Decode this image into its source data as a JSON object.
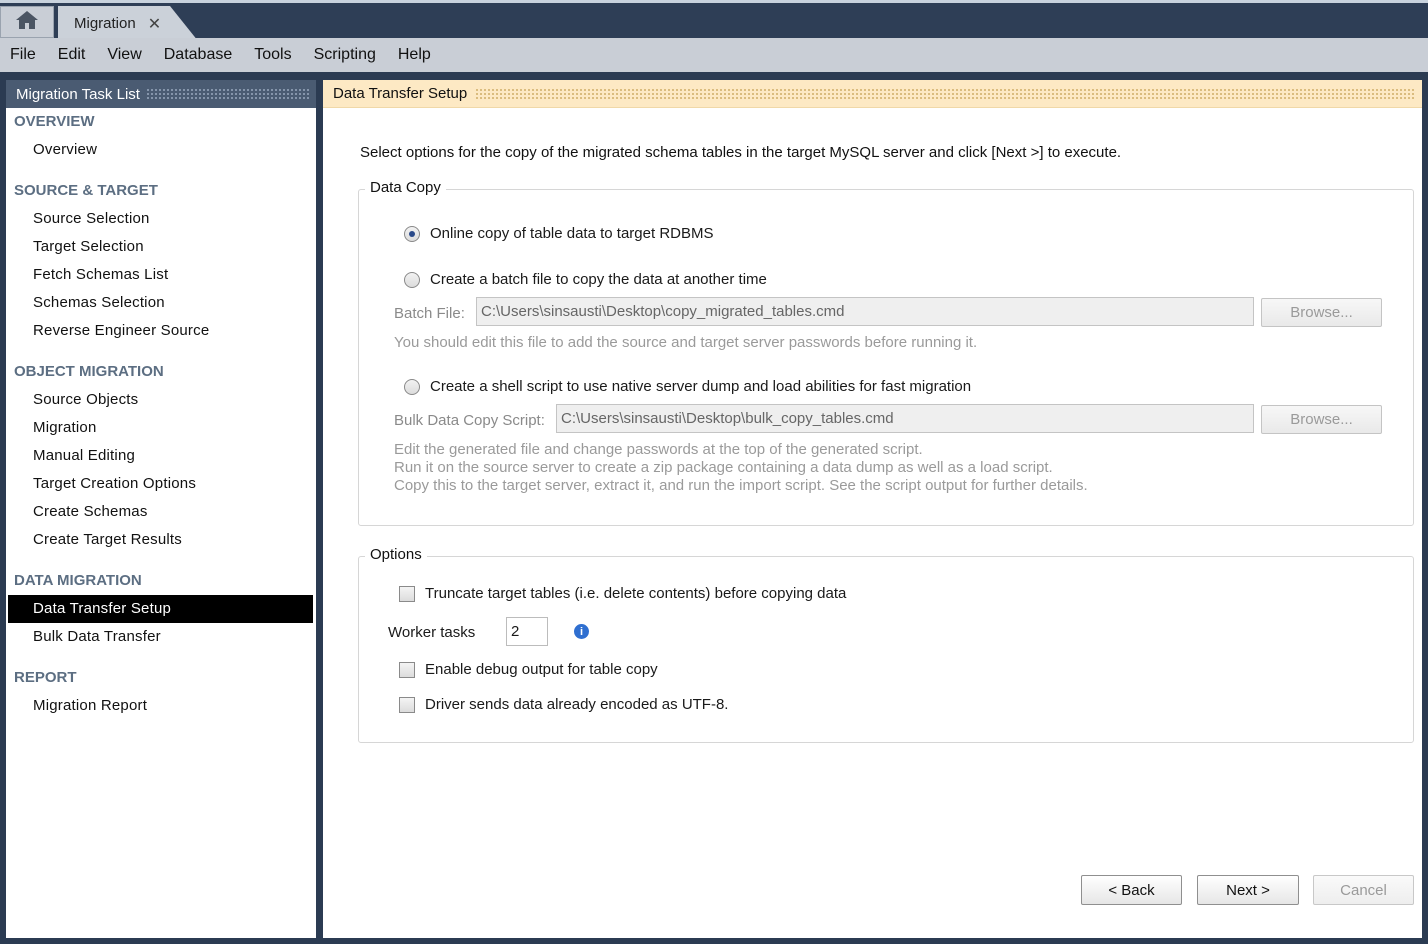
{
  "tabs": {
    "home_icon": "home-icon",
    "doc_tab_label": "Migration",
    "close_glyph": "✕"
  },
  "menu": [
    "File",
    "Edit",
    "View",
    "Database",
    "Tools",
    "Scripting",
    "Help"
  ],
  "sidebar": {
    "title": "Migration Task List",
    "sections": [
      {
        "title": "OVERVIEW",
        "items": [
          "Overview"
        ]
      },
      {
        "title": "SOURCE & TARGET",
        "items": [
          "Source Selection",
          "Target Selection",
          "Fetch Schemas List",
          "Schemas Selection",
          "Reverse Engineer Source"
        ]
      },
      {
        "title": "OBJECT MIGRATION",
        "items": [
          "Source Objects",
          "Migration",
          "Manual Editing",
          "Target Creation Options",
          "Create Schemas",
          "Create Target Results"
        ]
      },
      {
        "title": "DATA MIGRATION",
        "items": [
          "Data Transfer Setup",
          "Bulk Data Transfer"
        ]
      },
      {
        "title": "REPORT",
        "items": [
          "Migration Report"
        ]
      }
    ],
    "active_item": "Data Transfer Setup"
  },
  "main": {
    "title": "Data Transfer Setup",
    "intro": "Select options for the copy of the migrated schema tables in the target MySQL server and click [Next >] to execute.",
    "data_copy": {
      "legend": "Data Copy",
      "option_online": "Online copy of table data to target RDBMS",
      "option_batch": "Create a batch file to copy the data at another time",
      "batch_file_label": "Batch File:",
      "batch_file_value": "C:\\Users\\sinsausti\\Desktop\\copy_migrated_tables.cmd",
      "browse_label": "Browse...",
      "batch_hint": "You should edit this file to add the source and target server passwords before running it.",
      "option_shell": "Create a shell script to use native server dump and load abilities for fast migration",
      "bulk_script_label": "Bulk Data Copy Script:",
      "bulk_script_value": "C:\\Users\\sinsausti\\Desktop\\bulk_copy_tables.cmd",
      "shell_hint_1": "Edit the generated file and change passwords at the top of the generated script.",
      "shell_hint_2": "Run it on the source server to create a zip package containing a data dump as well as a load script.",
      "shell_hint_3": "Copy this to the target server, extract it, and run the import script. See the script output for further details.",
      "selected": "online"
    },
    "options": {
      "legend": "Options",
      "truncate": "Truncate target tables (i.e. delete contents) before copying data",
      "worker_label": "Worker tasks",
      "worker_value": "2",
      "debug": "Enable debug output for table copy",
      "utf8": "Driver sends data already encoded as UTF-8."
    },
    "buttons": {
      "back": "< Back",
      "next": "Next >",
      "cancel": "Cancel"
    }
  }
}
